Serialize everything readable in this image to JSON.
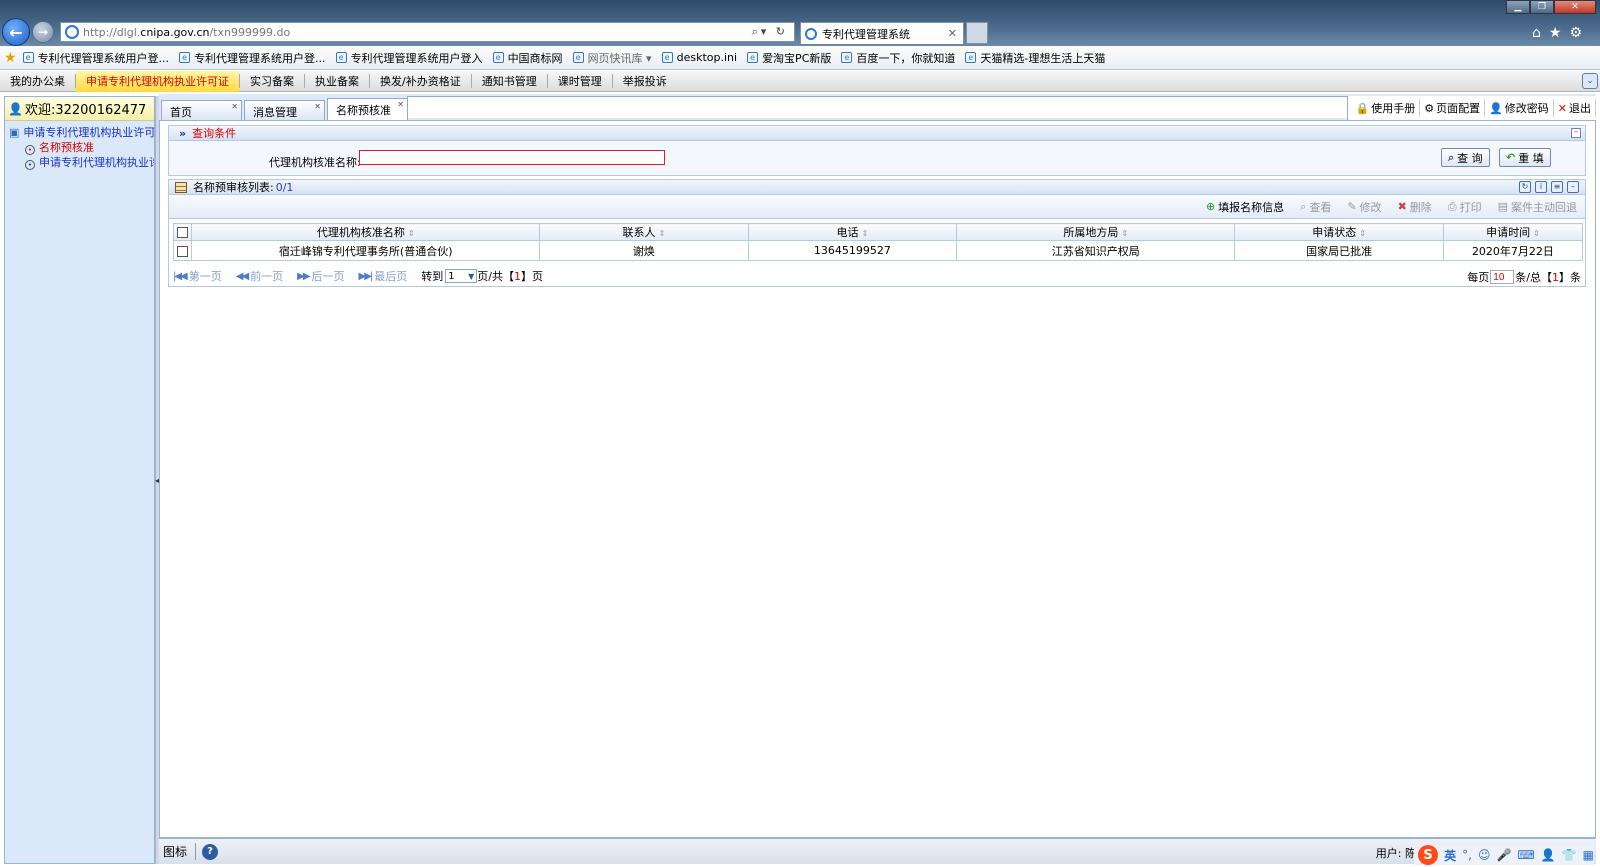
{
  "browser": {
    "address_prefix": "http://dlgl.",
    "address_host": "cnipa.gov.cn",
    "address_path": "/txn999999.do",
    "tab_title": "专利代理管理系统"
  },
  "favorites": [
    {
      "label": "专利代理管理系统用户登...",
      "dim": false
    },
    {
      "label": "专利代理管理系统用户登...",
      "dim": false
    },
    {
      "label": "专利代理管理系统用户登入",
      "dim": false
    },
    {
      "label": "中国商标网",
      "dim": false
    },
    {
      "label": "网页快讯库 ▾",
      "dim": true
    },
    {
      "label": "desktop.ini",
      "dim": false
    },
    {
      "label": "爱淘宝PC新版",
      "dim": false
    },
    {
      "label": "百度一下，你就知道",
      "dim": false
    },
    {
      "label": "天猫精选-理想生活上天猫",
      "dim": false
    }
  ],
  "menu": [
    {
      "label": "我的办公桌",
      "active": false
    },
    {
      "label": "申请专利代理机构执业许可证",
      "active": true
    },
    {
      "label": "实习备案",
      "active": false
    },
    {
      "label": "执业备案",
      "active": false
    },
    {
      "label": "换发/补办资格证",
      "active": false
    },
    {
      "label": "通知书管理",
      "active": false
    },
    {
      "label": "课时管理",
      "active": false
    },
    {
      "label": "举报投诉",
      "active": false
    }
  ],
  "left": {
    "welcome": "欢迎:32200162477",
    "tree_root": "申请专利代理机构执业许可证",
    "tree_children": [
      {
        "label": "名称预核准",
        "selected": true
      },
      {
        "label": "申请专利代理机构执业许可证",
        "selected": false
      }
    ]
  },
  "tabs": [
    {
      "label": "首页",
      "active": false
    },
    {
      "label": "消息管理",
      "active": false
    },
    {
      "label": "名称预核准",
      "active": true
    }
  ],
  "top_tools": [
    {
      "label": "使用手册",
      "icon": "manual-icon"
    },
    {
      "label": "页面配置",
      "icon": "config-icon"
    },
    {
      "label": "修改密码",
      "icon": "password-icon"
    },
    {
      "label": "退出",
      "icon": "exit-icon"
    }
  ],
  "query": {
    "header": "查询条件",
    "field_label": "代理机构核准名称:",
    "field_value": "",
    "search_label": "查 询",
    "reset_label": "重 填"
  },
  "list": {
    "title": "名称预审核列表:",
    "count": "0/1",
    "toolbar": [
      {
        "label": "填报名称信息",
        "enabled": true,
        "icon": "add-icon"
      },
      {
        "label": "查看",
        "enabled": false,
        "icon": "view-icon"
      },
      {
        "label": "修改",
        "enabled": false,
        "icon": "edit-icon"
      },
      {
        "label": "删除",
        "enabled": false,
        "icon": "delete-icon"
      },
      {
        "label": "打印",
        "enabled": false,
        "icon": "print-icon"
      },
      {
        "label": "案件主动回退",
        "enabled": false,
        "icon": "rollback-icon"
      }
    ],
    "columns": [
      "代理机构核准名称",
      "联系人",
      "电话",
      "所属地方局",
      "申请状态",
      "申请时间"
    ],
    "rows": [
      [
        "宿迁峰锦专利代理事务所(普通合伙)",
        "谢焕",
        "13645199527",
        "江苏省知识产权局",
        "国家局已批准",
        "2020年7月22日"
      ]
    ]
  },
  "pager": {
    "first": "第一页",
    "prev": "前一页",
    "next": "后一页",
    "last": "最后页",
    "goto": "转到",
    "page_value": "1",
    "page_suffix": "页/共",
    "total_pages": "1",
    "page_unit": "页",
    "per_page_label": "每页",
    "per_page": "10",
    "total_label": "条/总",
    "total_count": "1",
    "count_unit": "条"
  },
  "status": {
    "label": "图标",
    "user_label": "用户: 陈",
    "ime_lang": "英"
  }
}
